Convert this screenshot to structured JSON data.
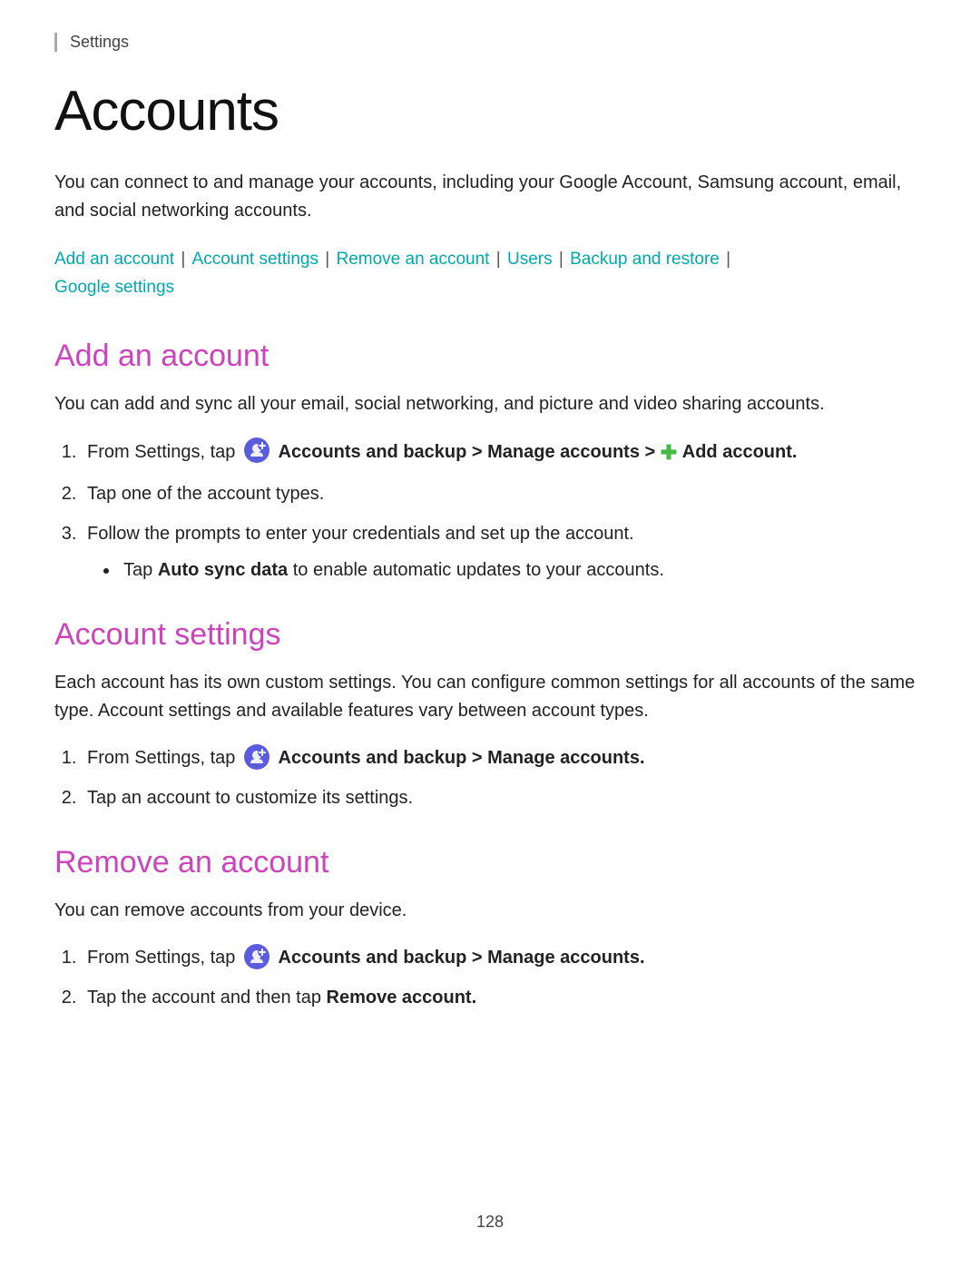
{
  "header": {
    "settings_label": "Settings"
  },
  "page": {
    "title": "Accounts",
    "intro": "You can connect to and manage your accounts, including your Google Account, Samsung account, email, and social networking accounts.",
    "page_number": "128"
  },
  "nav": {
    "links": [
      {
        "label": "Add an account",
        "id": "add"
      },
      {
        "label": "Account settings",
        "id": "settings"
      },
      {
        "label": "Remove an account",
        "id": "remove"
      },
      {
        "label": "Users",
        "id": "users"
      },
      {
        "label": "Backup and restore",
        "id": "backup"
      },
      {
        "label": "Google settings",
        "id": "google"
      }
    ]
  },
  "sections": {
    "add_account": {
      "title": "Add an account",
      "intro": "You can add and sync all your email, social networking, and picture and video sharing accounts.",
      "steps": [
        {
          "id": 1,
          "text_before": "From Settings, tap",
          "bold": "Accounts and backup > Manage accounts >",
          "icon": true,
          "plus": true,
          "bold_after": "Add account."
        },
        {
          "id": 2,
          "text": "Tap one of the account types."
        },
        {
          "id": 3,
          "text": "Follow the prompts to enter your credentials and set up the account."
        }
      ],
      "bullet": "Tap Auto sync data to enable automatic updates to your accounts."
    },
    "account_settings": {
      "title": "Account settings",
      "intro": "Each account has its own custom settings. You can configure common settings for all accounts of the same type. Account settings and available features vary between account types.",
      "steps": [
        {
          "id": 1,
          "text_before": "From Settings, tap",
          "bold": "Accounts and backup > Manage accounts.",
          "icon": true
        },
        {
          "id": 2,
          "text": "Tap an account to customize its settings."
        }
      ]
    },
    "remove_account": {
      "title": "Remove an account",
      "intro": "You can remove accounts from your device.",
      "steps": [
        {
          "id": 1,
          "text_before": "From Settings, tap",
          "bold": "Accounts and backup > Manage accounts.",
          "icon": true
        },
        {
          "id": 2,
          "text_before": "Tap the account and then tap",
          "bold": "Remove account."
        }
      ]
    }
  }
}
